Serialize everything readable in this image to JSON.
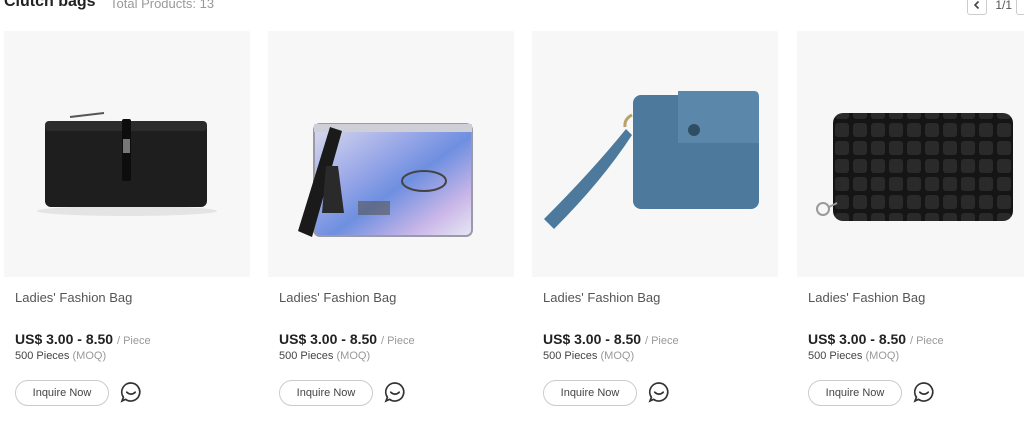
{
  "section": {
    "title": "Clutch bags",
    "total": "Total Products: 13",
    "page_indicator": "1/1"
  },
  "icons": {
    "prev": "chevron-left-icon",
    "next": "chevron-right-icon",
    "chat": "chat-bubble-icon"
  },
  "products": [
    {
      "name": "Ladies' Fashion Bag",
      "price": "US$ 3.00 - 8.50",
      "unit": "/ Piece",
      "moq": "500 Pieces",
      "moq_note": "(MOQ)",
      "inquire_label": "Inquire Now",
      "color": "#1e1e1e"
    },
    {
      "name": "Ladies' Fashion Bag",
      "price": "US$ 3.00 - 8.50",
      "unit": "/ Piece",
      "moq": "500 Pieces",
      "moq_note": "(MOQ)",
      "inquire_label": "Inquire Now",
      "color": "#b7b9e6"
    },
    {
      "name": "Ladies' Fashion Bag",
      "price": "US$ 3.00 - 8.50",
      "unit": "/ Piece",
      "moq": "500 Pieces",
      "moq_note": "(MOQ)",
      "inquire_label": "Inquire Now",
      "color": "#4d7a9c"
    },
    {
      "name": "Ladies' Fashion Bag",
      "price": "US$ 3.00 - 8.50",
      "unit": "/ Piece",
      "moq": "500 Pieces",
      "moq_note": "(MOQ)",
      "inquire_label": "Inquire Now",
      "color": "#151515"
    }
  ]
}
